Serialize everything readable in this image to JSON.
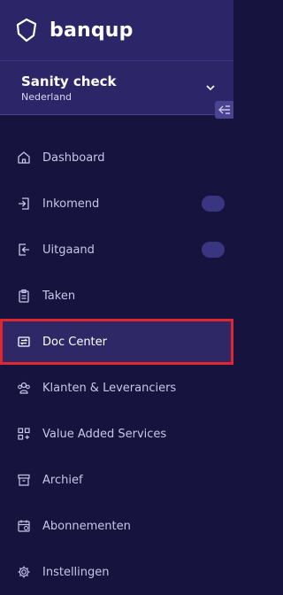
{
  "brand": {
    "name": "banqup",
    "logo_icon": "shield-logo-icon"
  },
  "organization": {
    "name": "Sanity check",
    "country": "Nederland"
  },
  "nav": [
    {
      "label": "Dashboard",
      "icon": "home-icon"
    },
    {
      "label": "Inkomend",
      "icon": "inbox-arrow-icon"
    },
    {
      "label": "Uitgaand",
      "icon": "outbox-arrow-icon"
    },
    {
      "label": "Taken",
      "icon": "clipboard-icon"
    },
    {
      "label": "Doc Center",
      "icon": "doc-exchange-icon",
      "active": true
    },
    {
      "label": "Klanten & Leveranciers",
      "icon": "users-icon"
    },
    {
      "label": "Value Added Services",
      "icon": "apps-plus-icon"
    },
    {
      "label": "Archief",
      "icon": "archive-icon"
    },
    {
      "label": "Abonnementen",
      "icon": "calendar-icon"
    },
    {
      "label": "Instellingen",
      "icon": "gear-icon"
    }
  ],
  "colors": {
    "background": "#16133f",
    "header": "#2c2669",
    "active_item": "#2e2866",
    "highlight_border": "#e0262e",
    "text": "#c9c5ea"
  }
}
